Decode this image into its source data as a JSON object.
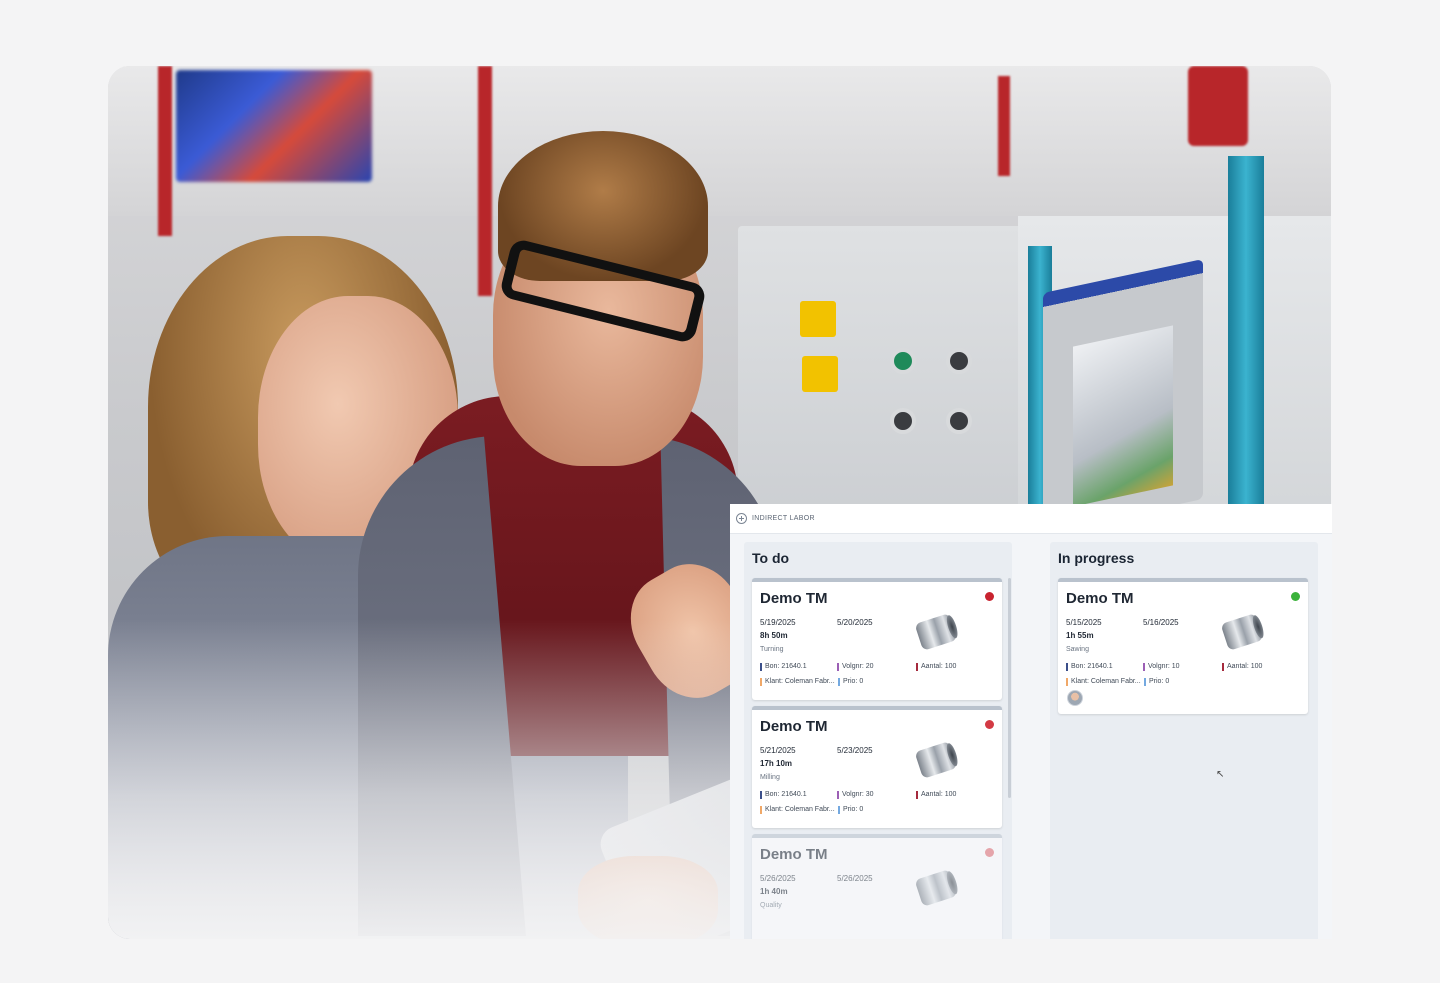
{
  "header": {
    "label": "INDIRECT LABOR"
  },
  "columns": [
    {
      "title": "To do",
      "cards": [
        {
          "title": "Demo TM",
          "status_color": "#c8232f",
          "start_date": "5/19/2025",
          "end_date": "5/20/2025",
          "duration": "8h 50m",
          "operation": "Turning",
          "bon": "Bon: 21640.1",
          "volgnr": "Volgnr: 20",
          "aantal": "Aantal: 100",
          "klant": "Klant: Coleman Fabr...",
          "prio": "Prio: 0"
        },
        {
          "title": "Demo TM",
          "status_color": "#d33a44",
          "start_date": "5/21/2025",
          "end_date": "5/23/2025",
          "duration": "17h 10m",
          "operation": "Milling",
          "bon": "Bon: 21640.1",
          "volgnr": "Volgnr: 30",
          "aantal": "Aantal: 100",
          "klant": "Klant: Coleman Fabr...",
          "prio": "Prio: 0"
        },
        {
          "title": "Demo TM",
          "status_color": "#e36b72",
          "start_date": "5/26/2025",
          "end_date": "5/26/2025",
          "duration": "1h 40m",
          "operation": "Quality"
        }
      ]
    },
    {
      "title": "In progress",
      "cards": [
        {
          "title": "Demo TM",
          "status_color": "#3bb23b",
          "start_date": "5/15/2025",
          "end_date": "5/16/2025",
          "duration": "1h 55m",
          "operation": "Sawing",
          "bon": "Bon: 21640.1",
          "volgnr": "Volgnr: 10",
          "aantal": "Aantal: 100",
          "klant": "Klant: Coleman Fabr...",
          "prio": "Prio: 0"
        }
      ]
    }
  ]
}
